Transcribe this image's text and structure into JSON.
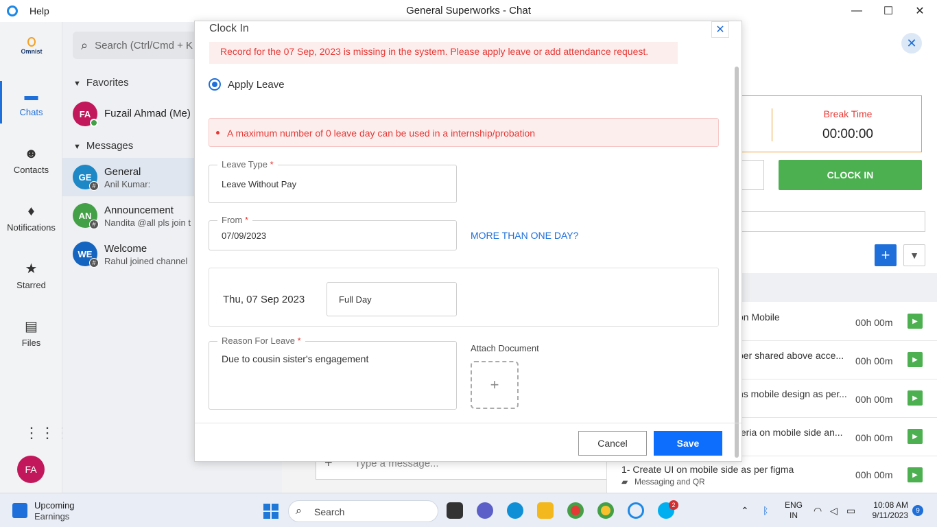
{
  "titlebar": {
    "help": "Help",
    "title": "General Superworks - Chat",
    "minimize": "—",
    "maximize": "☐",
    "close": "✕"
  },
  "nav": {
    "logo": "Omnist",
    "items": [
      {
        "label": "Chats",
        "icon": "chat-bubble-icon"
      },
      {
        "label": "Contacts",
        "icon": "contacts-icon"
      },
      {
        "label": "Notifications",
        "icon": "bell-icon"
      },
      {
        "label": "Starred",
        "icon": "star-icon"
      },
      {
        "label": "Files",
        "icon": "files-icon"
      }
    ],
    "avatar": "FA"
  },
  "chatlist": {
    "search_placeholder": "Search (Ctrl/Cmd + K",
    "favorites_header": "Favorites",
    "messages_header": "Messages",
    "favorites": [
      {
        "initials": "FA",
        "name": "Fuzail Ahmad (Me)",
        "color": "#c2185b"
      }
    ],
    "messages": [
      {
        "initials": "GE",
        "name": "General",
        "sub": "Anil Kumar:",
        "color": "#1e88c7"
      },
      {
        "initials": "AN",
        "name": "Announcement",
        "sub": "Nandita   @all pls join t",
        "color": "#43a047"
      },
      {
        "initials": "WE",
        "name": "Welcome",
        "sub": "Rahul joined channel",
        "color": "#1565c0"
      }
    ]
  },
  "background": {
    "message_placeholder": "Type a message...",
    "break_time_label": "Break Time",
    "break_time_value": "00:00:00",
    "clock_in_button": "CLOCK IN",
    "tasks": [
      {
        "title": "on Mobile",
        "duration": "00h 00m"
      },
      {
        "title": "per shared above acce...",
        "duration": "00h 00m"
      },
      {
        "title": "ns mobile design as per...",
        "duration": "00h 00m"
      },
      {
        "title": "teria on mobile side an...",
        "duration": "00h 00m"
      },
      {
        "title": "1- Create UI on mobile side as per figma",
        "sub": "Messaging and QR",
        "duration": "00h 00m"
      }
    ]
  },
  "modal": {
    "title": "Clock In",
    "missing_record_warning": "Record for the 07 Sep, 2023 is missing in the system. Please apply leave or add attendance request.",
    "option_label": "Apply Leave",
    "alert_text": "A maximum number of 0 leave day can be used in a internship/probation",
    "leave_type_label": "Leave Type",
    "leave_type_value": "Leave Without Pay",
    "from_label": "From",
    "from_value": "07/09/2023",
    "more_than_one_day": "MORE THAN ONE DAY?",
    "day_date": "Thu, 07 Sep 2023",
    "day_duration": "Full Day",
    "reason_label": "Reason For Leave",
    "reason_value": "Due to  cousin sister's engagement",
    "attach_label": "Attach Document",
    "attach_plus": "+",
    "required_mark": "*",
    "cancel_button": "Cancel",
    "save_button": "Save"
  },
  "taskbar": {
    "weather_line1": "Upcoming",
    "weather_line2": "Earnings",
    "search_label": "Search",
    "lang_line1": "ENG",
    "lang_line2": "IN",
    "time": "10:08 AM",
    "date": "9/11/2023",
    "notification_count": "9",
    "skype_badge": "2"
  }
}
